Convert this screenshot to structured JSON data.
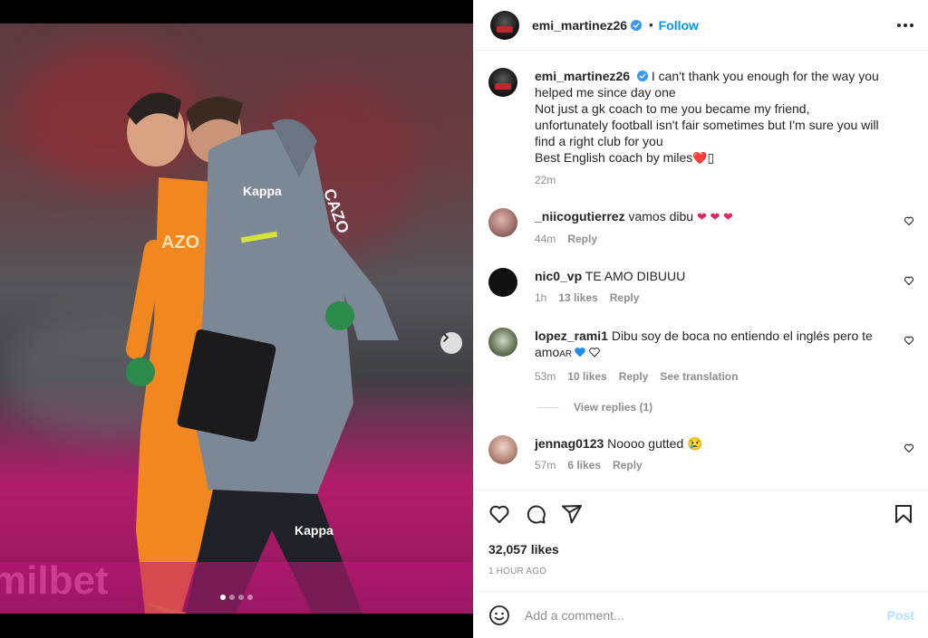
{
  "media": {
    "next_icon": "chevron-right-icon",
    "slide_count": 4,
    "active_slide": 1
  },
  "header": {
    "username": "emi_martinez26",
    "separator": "•",
    "follow_label": "Follow",
    "more_icon": "more-horizontal-icon"
  },
  "caption": {
    "username": "emi_martinez26",
    "text_line1": "I can't thank you enough for the way you helped me since day one",
    "text_line2": "Not just a gk coach to me you became my friend, unfortunately football isn't fair sometimes but I'm sure you will find a right club for you",
    "text_line3": "Best English coach by miles",
    "emoji_suffix": "❤️",
    "emoji_box": "▯",
    "time": "22m"
  },
  "comments": [
    {
      "username": "_niicogutierrez",
      "text": "vamos dibu",
      "emoji": "❤ ❤ ❤",
      "time": "44m",
      "likes": "",
      "reply": "Reply",
      "translate": ""
    },
    {
      "username": "nic0_vp",
      "text": "TE AMO DIBUUU",
      "emoji": "",
      "time": "1h",
      "likes": "13 likes",
      "reply": "Reply",
      "translate": ""
    },
    {
      "username": "lopez_rami1",
      "text": "Dibu soy de boca no entiendo el inglés pero te amo",
      "suffix": "AR",
      "emoji": "",
      "time": "53m",
      "likes": "10 likes",
      "reply": "Reply",
      "translate": "See translation"
    },
    {
      "username": "jennag0123",
      "text": "Noooo gutted",
      "emoji": "😢",
      "time": "57m",
      "likes": "6 likes",
      "reply": "Reply",
      "translate": ""
    }
  ],
  "view_replies": "View replies (1)",
  "actions": {
    "likes": "32,057 likes",
    "posted": "1 HOUR AGO"
  },
  "composer": {
    "placeholder": "Add a comment...",
    "post_label": "Post"
  },
  "colors": {
    "accent": "#0095f6",
    "post_disabled": "#b2dffc",
    "muted": "#8e8e8e",
    "heart_red": "#e0245e",
    "heart_blue": "#1d8bf0"
  }
}
